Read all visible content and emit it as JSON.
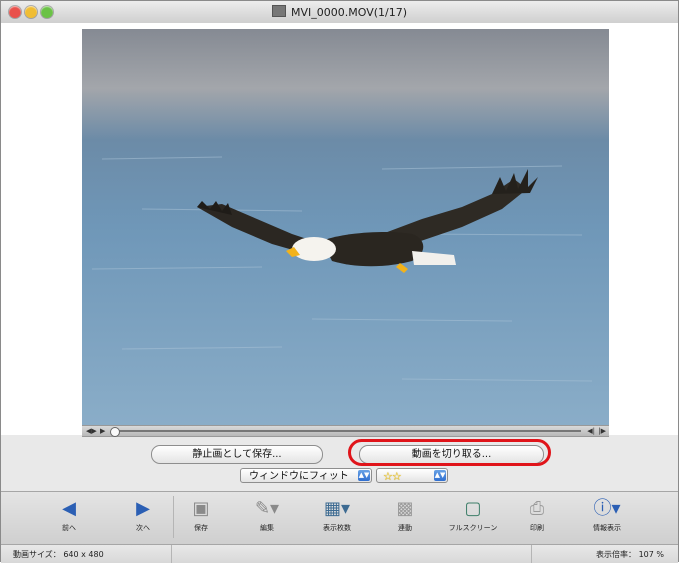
{
  "window": {
    "title": "MVI_0000.MOV(1/17)"
  },
  "buttons": {
    "save_still": "静止画として保存...",
    "cut_movie": "動画を切り取る..."
  },
  "selects": {
    "fit": "ウィンドウにフィット",
    "rating_stars": "☆☆"
  },
  "toolbar": {
    "items": [
      {
        "label": "前へ",
        "icon": "prev-arrow-icon"
      },
      {
        "label": "次へ",
        "icon": "next-arrow-icon"
      },
      {
        "label": "保存",
        "icon": "save-icon"
      },
      {
        "label": "編集",
        "icon": "edit-icon"
      },
      {
        "label": "表示枚数",
        "icon": "display-count-icon"
      },
      {
        "label": "連動",
        "icon": "sync-icon"
      },
      {
        "label": "フルスクリーン",
        "icon": "fullscreen-icon"
      },
      {
        "label": "印刷",
        "icon": "print-icon"
      },
      {
        "label": "情報表示",
        "icon": "info-icon"
      }
    ]
  },
  "status": {
    "size_label": "動画サイズ：",
    "size_value": "640 x 480",
    "zoom_label": "表示倍率：",
    "zoom_value": "107 %"
  },
  "colors": {
    "highlight": "#e0141a",
    "accent": "#2f6fd0"
  }
}
